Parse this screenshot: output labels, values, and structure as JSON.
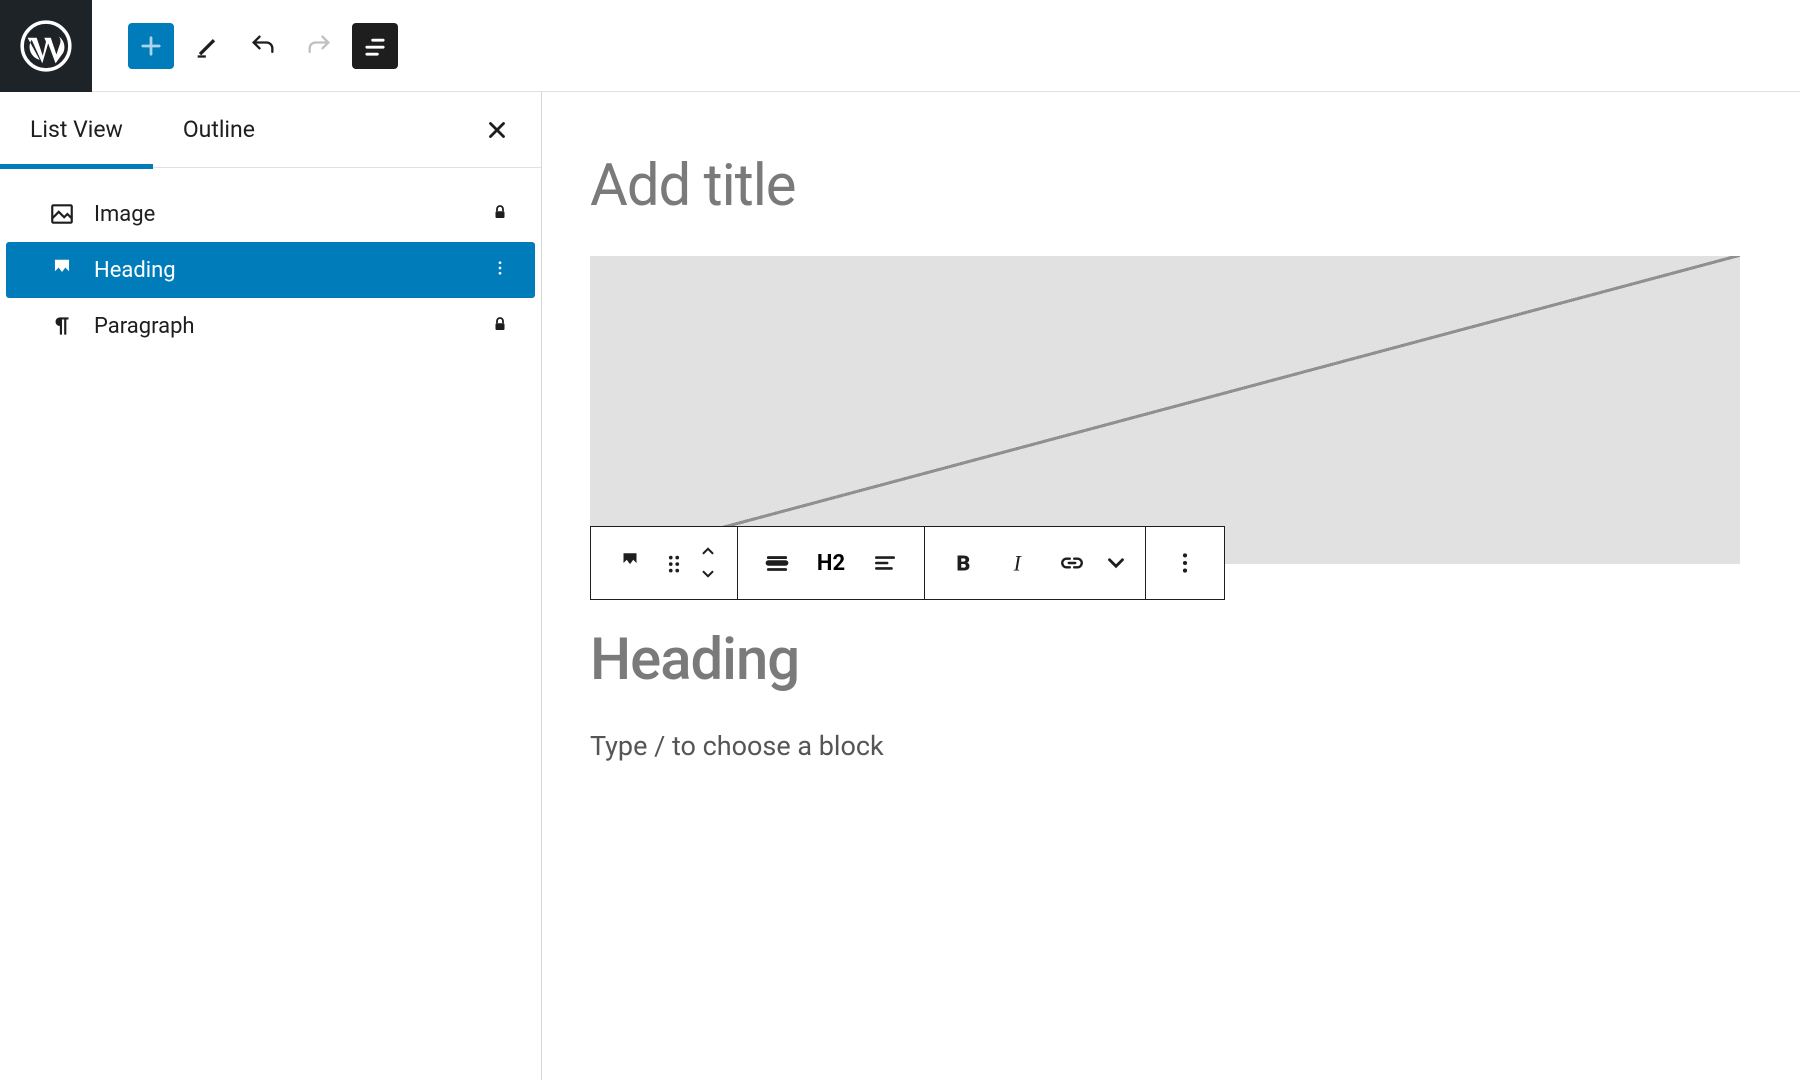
{
  "tabs": {
    "listview": "List View",
    "outline": "Outline"
  },
  "blocks": {
    "image": "Image",
    "heading": "Heading",
    "paragraph": "Paragraph"
  },
  "editor": {
    "title_placeholder": "Add title",
    "heading_placeholder": "Heading",
    "paragraph_placeholder": "Type / to choose a block"
  },
  "block_toolbar": {
    "heading_level": "H2"
  }
}
